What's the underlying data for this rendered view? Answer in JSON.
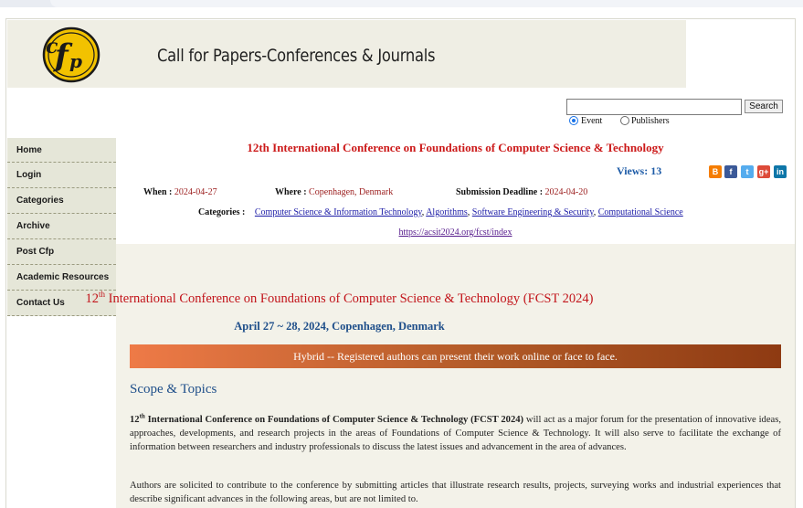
{
  "header": {
    "site_title": "Call for Papers-Conferences & Journals",
    "logo_text": "cfp"
  },
  "search": {
    "button_label": "Search",
    "input_value": "",
    "options": [
      {
        "label": "Event",
        "checked": true
      },
      {
        "label": "Publishers",
        "checked": false
      }
    ]
  },
  "sidebar": {
    "items": [
      {
        "label": "Home"
      },
      {
        "label": "Login"
      },
      {
        "label": "Categories"
      },
      {
        "label": "Archive"
      },
      {
        "label": "Post Cfp"
      },
      {
        "label": "Academic Resources"
      },
      {
        "label": "Contact Us"
      }
    ]
  },
  "event": {
    "title": "12th International Conference on Foundations of Computer Science & Technology",
    "views_label": "Views:",
    "views_count": "13",
    "when_label": "When :",
    "when_value": "2024-04-27",
    "where_label": "Where :",
    "where_value": "Copenhagen, Denmark",
    "deadline_label": "Submission Deadline :",
    "deadline_value": "2024-04-20",
    "categories_label": "Categories :",
    "categories": [
      "Computer Science & Information Technology",
      "Algorithms",
      "Software Engineering & Security",
      "Computational Science"
    ],
    "url": "https://acsit2024.org/fcst/index"
  },
  "share": {
    "icons": [
      {
        "name": "blogger-icon",
        "glyph": "B",
        "color": "#f57d00"
      },
      {
        "name": "facebook-icon",
        "glyph": "f",
        "color": "#3b5998"
      },
      {
        "name": "twitter-icon",
        "glyph": "t",
        "color": "#55acee"
      },
      {
        "name": "googleplus-icon",
        "glyph": "g+",
        "color": "#dd4b39"
      },
      {
        "name": "linkedin-icon",
        "glyph": "in",
        "color": "#0e76a8"
      }
    ]
  },
  "details": {
    "title_number": "12",
    "title_suffix": "th",
    "title_rest": " International Conference on Foundations of Computer Science & Technology (FCST 2024)",
    "date_location": "April 27 ~ 28, 2024, Copenhagen, Denmark",
    "hybrid_notice": "Hybrid -- Registered authors can present their work online or face to face.",
    "scope_heading": "Scope & Topics",
    "para1_bold_number": "12",
    "para1_bold_suffix": "th",
    "para1_bold_rest": " International Conference on Foundations of Computer Science & Technology (FCST 2024)",
    "para1_text": " will act as a major forum for the presentation of innovative ideas, approaches, developments, and research projects in the areas of Foundations of Computer Science & Technology. It will also serve to facilitate the exchange of information between researchers and industry professionals to discuss the latest issues and advancement in the area of advances.",
    "para2_text": "Authors are solicited to contribute to the conference by submitting articles that illustrate research results, projects, surveying works and industrial experiences that describe significant advances in the following areas, but are not limited to."
  }
}
